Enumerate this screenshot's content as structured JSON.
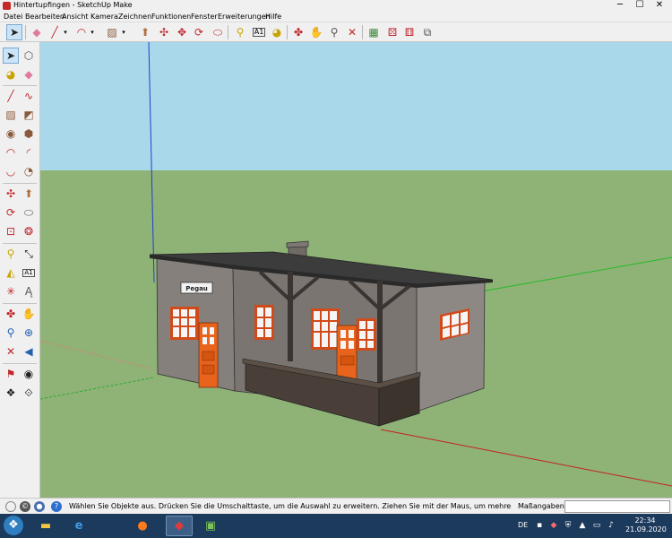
{
  "window": {
    "title": "Hintertupfingen - SketchUp Make",
    "minimize": "─",
    "maximize": "☐",
    "close": "✕"
  },
  "menu": [
    "Datei",
    "Bearbeiten",
    "Ansicht",
    "Kamera",
    "Zeichnen",
    "Funktionen",
    "Fenster",
    "Erweiterungen",
    "Hilfe"
  ],
  "toolbar": {
    "tools": [
      "select-tool",
      "eraser-tool",
      "line-tool",
      "arc-tool",
      "rectangle-tool",
      "push-pull-tool",
      "move-tool",
      "rotate-tool",
      "offset-tool",
      "tape-measure-tool",
      "text-tool",
      "paint-bucket-tool",
      "orbit-tool",
      "pan-tool",
      "zoom-tool",
      "zoom-extents-tool",
      "warehouse-tool",
      "extension-warehouse-tool",
      "share-model-tool",
      "layout-tool"
    ]
  },
  "palette": {
    "tools": [
      "select",
      "make-component",
      "paint-bucket",
      "eraser",
      "line",
      "freehand",
      "rectangle",
      "rotated-rectangle",
      "circle",
      "polygon",
      "arc",
      "two-point-arc",
      "three-point-arc",
      "pie",
      "move",
      "push-pull",
      "rotate",
      "follow-me",
      "scale",
      "offset",
      "tape-measure",
      "dimension",
      "protractor",
      "text",
      "axes",
      "3d-text",
      "orbit",
      "pan",
      "zoom",
      "zoom-window",
      "zoom-extents",
      "previous-view",
      "position-camera",
      "look-around",
      "walk",
      "section-plane"
    ],
    "text_tool_label": "A1"
  },
  "scene": {
    "sign_text": "Pegau",
    "colors": {
      "sky": "#a8d8ea",
      "ground": "#8fb377",
      "wall": "#8a8580",
      "roof": "#3a3a3a",
      "door": "#e8631c",
      "window_frame": "#d14a1a",
      "fence": "#4a3f38"
    }
  },
  "status": {
    "text": "Wählen Sie Objekte aus. Drücken Sie die Umschalttaste, um die Auswahl zu erweitern. Ziehen Sie mit der Maus, um mehrere Objekte auszuwä...",
    "measurements_label": "Maßangaben",
    "measurements_value": ""
  },
  "taskbar": {
    "apps": [
      "file-explorer",
      "internet-explorer",
      "firefox",
      "sketchup",
      "train-app"
    ],
    "language": "DE",
    "time": "22:34",
    "date": "21.09.2020"
  }
}
